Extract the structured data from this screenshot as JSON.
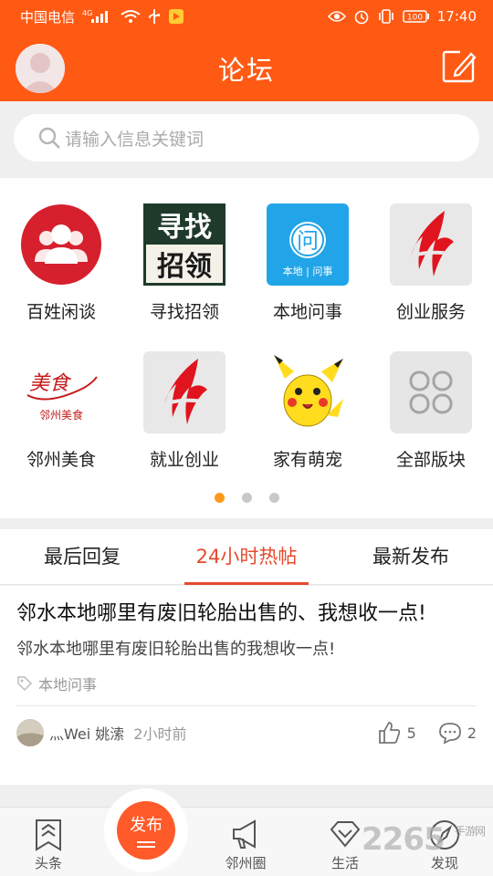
{
  "status_bar": {
    "carrier": "中国电信",
    "network": "4G",
    "battery": "100",
    "time": "17:40"
  },
  "header": {
    "title": "论坛"
  },
  "search": {
    "placeholder": "请输入信息关键词"
  },
  "categories": [
    {
      "label": "百姓闲谈",
      "icon": "people-group-icon"
    },
    {
      "label": "寻找招领",
      "icon": "lost-found-icon",
      "icon_text_1": "寻找",
      "icon_text_2": "招领"
    },
    {
      "label": "本地问事",
      "icon": "local-ask-icon",
      "icon_text_1": "问",
      "icon_text_2": "本地 | 问事"
    },
    {
      "label": "创业服务",
      "icon": "red-flame-logo-icon"
    },
    {
      "label": "邻州美食",
      "icon": "food-logo-icon",
      "icon_text_1": "美食",
      "icon_text_2": "邻州美食"
    },
    {
      "label": "就业创业",
      "icon": "red-flame-logo-icon"
    },
    {
      "label": "家有萌宠",
      "icon": "pikachu-icon"
    },
    {
      "label": "全部版块",
      "icon": "four-petal-grid-icon"
    }
  ],
  "pager": {
    "total": 3,
    "active": 0
  },
  "tabs": [
    {
      "label": "最后回复",
      "active": false
    },
    {
      "label": "24小时热帖",
      "active": true
    },
    {
      "label": "最新发布",
      "active": false
    }
  ],
  "post": {
    "title": "邻水本地哪里有废旧轮胎出售的、我想收一点!",
    "excerpt": "邻水本地哪里有废旧轮胎出售的我想收一点!",
    "tag": "本地问事",
    "author": "灬Wei 姚溹",
    "time": "2小时前",
    "likes": "5",
    "comments": "2"
  },
  "bottom_nav": {
    "headlines": "头条",
    "publish": "发布",
    "circle": "邻州圈",
    "life": "生活",
    "discover": "发现"
  },
  "watermark": {
    "brand": "2265",
    "site": "手游网"
  },
  "colors": {
    "brand_orange": "#ff5a14",
    "active_tab_red": "#e64a2f",
    "pager_active": "#ff9a1a"
  }
}
